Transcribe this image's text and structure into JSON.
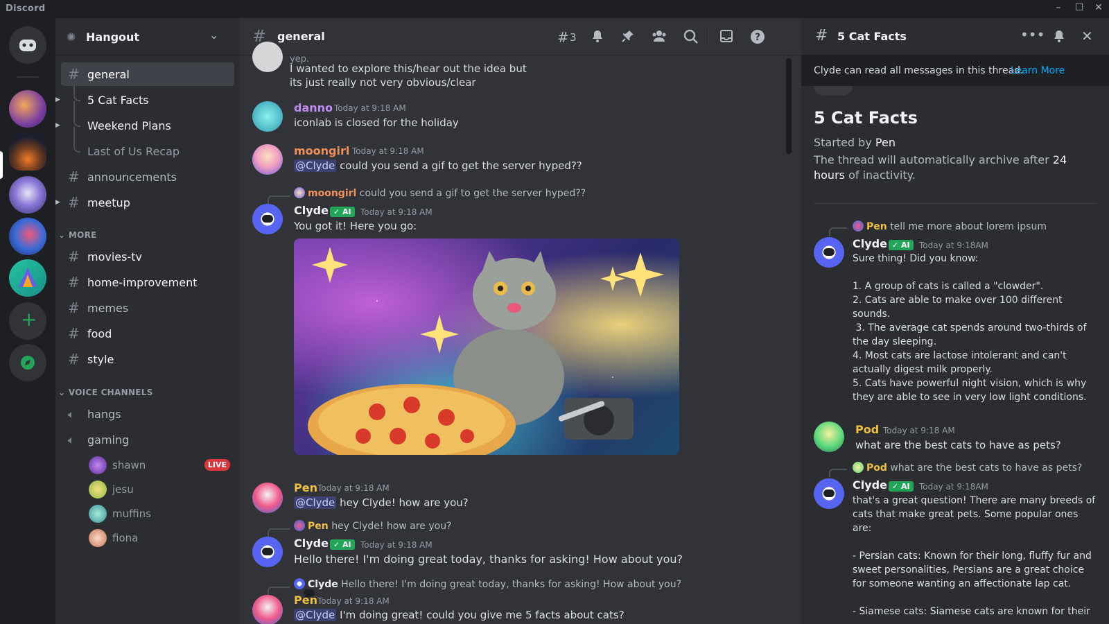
{
  "app": {
    "name": "Discord"
  },
  "server": {
    "name": "Hangout"
  },
  "channels": {
    "general": "general",
    "threads": [
      "5 Cat Facts",
      "Weekend Plans",
      "Last of Us Recap"
    ],
    "announcements": "announcements",
    "meetup": "meetup",
    "more_category": "MORE",
    "more": [
      "movies-tv",
      "home-improvement",
      "memes",
      "food",
      "style"
    ],
    "voice_category": "VOICE CHANNELS",
    "voice": [
      "hangs",
      "gaming"
    ],
    "voice_users": [
      "shawn",
      "jesu",
      "muffins",
      "fiona"
    ],
    "live_badge": "LIVE"
  },
  "chat": {
    "title": "general",
    "threads_count": "3",
    "top_partial_1": "yep.",
    "top_partial_2": "I wanted to explore this/hear out the idea but",
    "top_partial_3": "its just really not very obvious/clear",
    "messages": {
      "danno": {
        "user": "danno",
        "time": "Today at 9:18 AM",
        "text": "iconlab is closed for the holiday"
      },
      "moongirl": {
        "user": "moongirl",
        "time": "Today at 9:18 AM",
        "mention": "@Clyde",
        "text": "could you send a gif to get the server hyped??"
      },
      "clyde1": {
        "reply_user": "moongirl",
        "reply_text": "could you send a gif to get the server hyped??",
        "user": "Clyde",
        "tag": "✓ AI",
        "time": "Today at 9:18 AM",
        "text": "You got it! Here you go:"
      },
      "pen1": {
        "user": "Pen",
        "time": "Today at 9:18 AM",
        "mention": "@Clyde",
        "text": "hey Clyde! how are you?"
      },
      "clyde2": {
        "reply_user": "Pen",
        "reply_text": "hey Clyde! how are you?",
        "user": "Clyde",
        "tag": "✓ AI",
        "time": "Today at 9:18 AM",
        "text": "Hello there! I'm doing great today, thanks for asking! How about you?"
      },
      "pen2": {
        "reply_user": "Clyde",
        "reply_text": "Hello there! I'm doing great today, thanks for asking! How about you?",
        "user": "Pen",
        "time": "Today at 9:18 AM",
        "mention": "@Clyde",
        "text": "I'm doing great! could you give me 5 facts about cats?"
      }
    }
  },
  "thread_panel": {
    "title": "5 Cat Facts",
    "notice": "Clyde can read all messages in this thread.",
    "learn_more": "Learn More",
    "heading": "5 Cat Facts",
    "started_prefix": "Started by",
    "started_by": "Pen",
    "archive_prefix": "The thread will automatically archive after",
    "archive_bold": "24 hours",
    "archive_suffix": "of inactivity.",
    "reply1_user": "Pen",
    "reply1_text": "tell me more about lorem ipsum",
    "clyde_a_user": "Clyde",
    "clyde_a_tag": "✓ AI",
    "clyde_a_time": "Today at 9:18AM",
    "clyde_a_intro": "Sure thing! Did you know:",
    "facts": [
      "1. A group of cats is called a \"clowder\".",
      "2. Cats are able to make over 100 different",
      "sounds.",
      " 3. The average cat spends around two-thirds of",
      "the day sleeping.",
      "4. Most cats are lactose intolerant and can't",
      "actually digest milk properly.",
      "5. Cats have powerful night vision, which is why",
      "they are able to see in very low light conditions."
    ],
    "pod_user": "Pod",
    "pod_time": "Today at 9:18 AM",
    "pod_text": "what are the best cats to have as pets?",
    "reply2_user": "Pod",
    "reply2_text": "what are the best cats to have as pets?",
    "clyde_b_user": "Clyde",
    "clyde_b_tag": "✓ AI",
    "clyde_b_time": "Today at 9:18AM",
    "clyde_b_lines": [
      "that's a great question! There are many breeds of",
      "cats that make great pets. Some popular ones",
      "are:",
      "",
      "- Persian cats: Known for their long, fluffy fur and",
      "sweet personalities, Persians are a great choice",
      "for someone wanting an affectionate lap cat.",
      "",
      "- Siamese cats: Siamese cats are known for their"
    ]
  },
  "colors": {
    "blurple": "#5865f2",
    "green": "#23a559",
    "link": "#00a8fc",
    "live": "#da373c"
  }
}
